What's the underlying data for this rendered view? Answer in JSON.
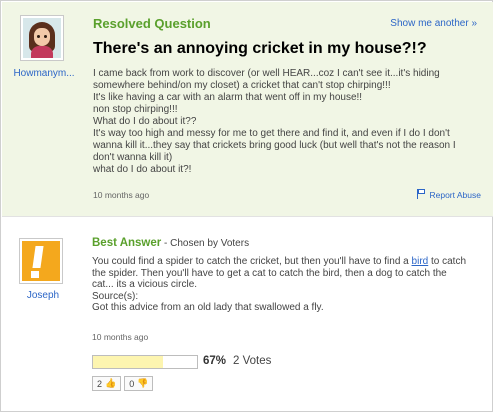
{
  "question": {
    "status": "Resolved Question",
    "show_more": "Show me another »",
    "username": "Howmanym...",
    "title": "There's an annoying cricket in my house?!?",
    "body_lines": [
      "I came back from work to discover (or well HEAR...coz I can't see it...it's hiding",
      "somewhere behind/on my closet) a cricket that can't stop chirping!!!",
      "It's like having a car with an alarm that went off in my house!!",
      "non stop chirping!!!",
      "What do I do about it??",
      "It's way too high and messy for me to get there and find it, and even if I do I don't",
      "wanna kill it...they say that crickets bring good luck (but well that's not the reason I",
      "don't wanna kill it)",
      "what do I do about it?!"
    ],
    "time": "10 months ago",
    "report_label": "Report Abuse",
    "report_icon": "flag-icon"
  },
  "answer": {
    "username": "Joseph",
    "best_label": "Best Answer",
    "chosen_by": " - Chosen by Voters",
    "line1_before": "You could find a spider to catch the cricket, but then you'll have to find a ",
    "line1_link": "bird",
    "line1_after": " to catch",
    "line2": "the spider. Then you'll have to get a cat to catch the bird, then a dog to catch the",
    "line3": "cat... its a vicious circle.",
    "source_label": "Source(s):",
    "source_text": "Got this advice from an old lady that swallowed a fly.",
    "time": "10 months ago",
    "vote_fraction": 0.67,
    "vote_pct": "67%",
    "vote_count": "2 Votes",
    "thumbs_up_count": "2",
    "thumbs_down_count": "0",
    "thumbs_up_icon": "thumbs-up-icon",
    "thumbs_down_icon": "thumbs-down-icon"
  },
  "colors": {
    "question_bg": "#f1f6e5",
    "accent_green": "#5aa02c",
    "link_blue": "#2c66c7",
    "vote_fill": "#fdf5b0"
  }
}
